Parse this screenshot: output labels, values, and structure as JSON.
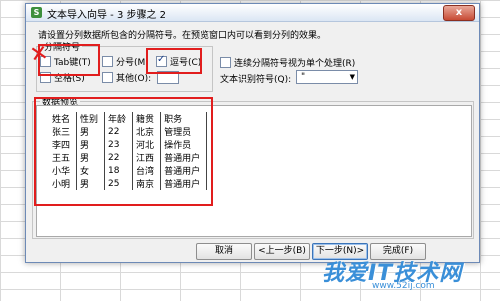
{
  "dialog": {
    "title": "文本导入向导 - 3 步骤之 2",
    "app_icon": "S",
    "close_label": "x",
    "instruction": "请设置分列数据所包含的分隔符号。在预览窗口内可以看到分列的效果。",
    "delimiters": {
      "group_label": "分隔符号",
      "tab": {
        "label": "Tab键(T)",
        "checked": false
      },
      "semicolon": {
        "label": "分号(M)",
        "checked": false
      },
      "comma": {
        "label": "逗号(C)",
        "checked": true
      },
      "space": {
        "label": "空格(S)",
        "checked": false
      },
      "other": {
        "label": "其他(O):",
        "checked": false,
        "value": ""
      }
    },
    "treat_consecutive": {
      "label": "连续分隔符号视为单个处理(R)",
      "checked": false
    },
    "text_qualifier": {
      "label": "文本识别符号(Q):",
      "value": "\""
    },
    "preview": {
      "label": "数据预览",
      "rows": [
        [
          "姓名",
          "性别",
          "年龄",
          "籍贯",
          "职务"
        ],
        [
          "张三",
          "男",
          "22",
          "北京",
          "管理员"
        ],
        [
          "李四",
          "男",
          "23",
          "河北",
          "操作员"
        ],
        [
          "王五",
          "男",
          "22",
          "江西",
          "普通用户"
        ],
        [
          "小华",
          "女",
          "18",
          "台湾",
          "普通用户"
        ],
        [
          "小明",
          "男",
          "25",
          "南京",
          "普通用户"
        ]
      ]
    },
    "buttons": {
      "cancel": "取消",
      "back": "<上一步(B)",
      "next": "下一步(N)>",
      "finish": "完成(F)"
    }
  },
  "watermark": {
    "main": "我爱IT技术网",
    "sub": "www.52ij.com"
  },
  "annotation_color": "#e11d1d"
}
